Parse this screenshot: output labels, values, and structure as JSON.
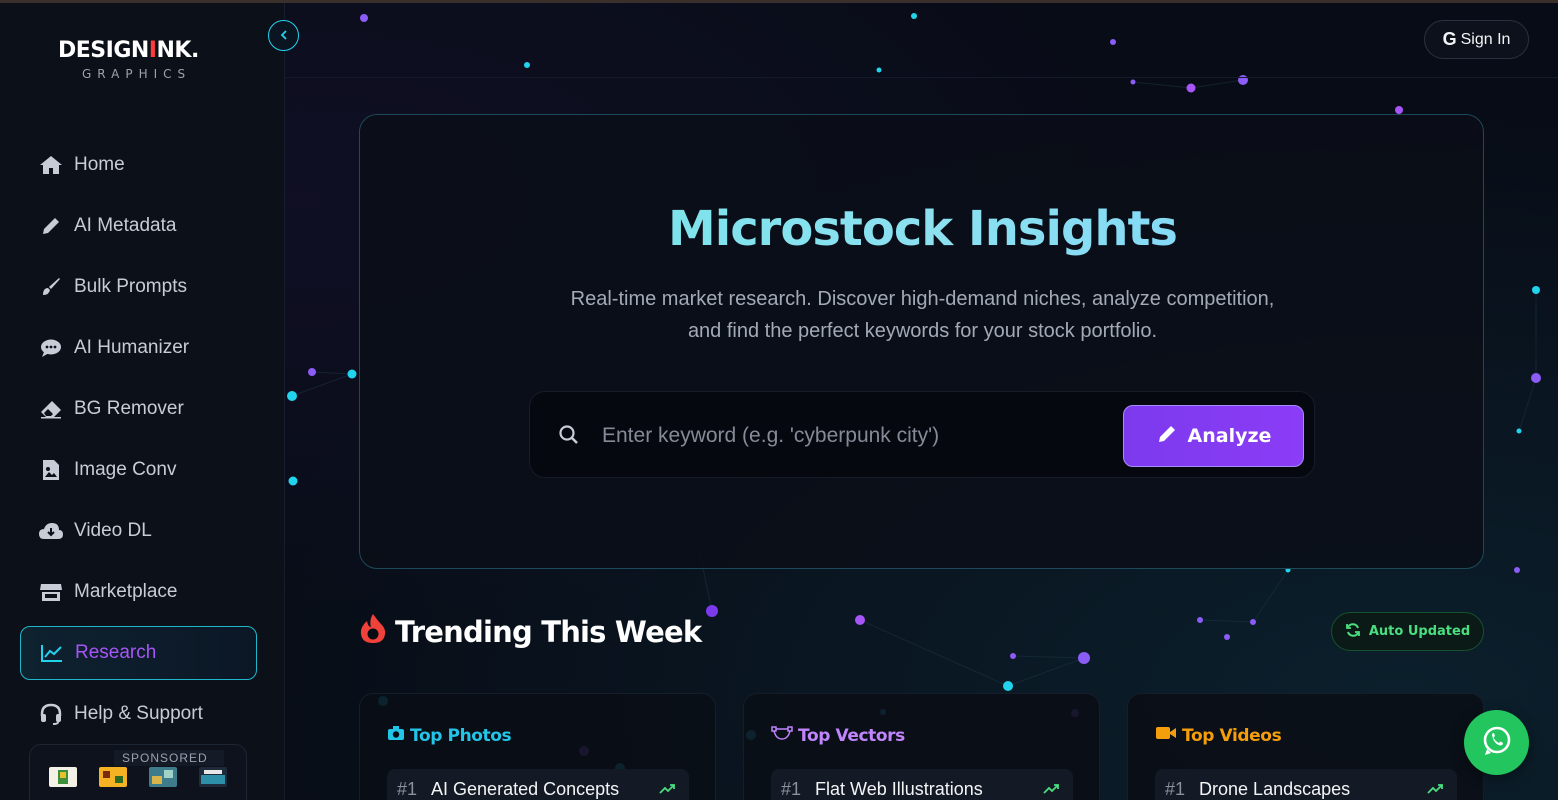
{
  "brand": {
    "name_pre": "DESIGN",
    "name_i": "I",
    "name_post": "NK.",
    "tagline": "GRAPHICS"
  },
  "sidebar": {
    "items": [
      {
        "label": "Home",
        "icon": "home-icon"
      },
      {
        "label": "AI Metadata",
        "icon": "pencil-icon"
      },
      {
        "label": "Bulk Prompts",
        "icon": "brush-icon"
      },
      {
        "label": "AI Humanizer",
        "icon": "chat-icon"
      },
      {
        "label": "BG Remover",
        "icon": "eraser-icon"
      },
      {
        "label": "Image Conv",
        "icon": "file-image-icon"
      },
      {
        "label": "Video DL",
        "icon": "cloud-download-icon"
      },
      {
        "label": "Marketplace",
        "icon": "store-icon"
      },
      {
        "label": "Research",
        "icon": "chart-line-icon",
        "active": true
      },
      {
        "label": "Help & Support",
        "icon": "headset-icon"
      }
    ],
    "sponsored_label": "SPONSORED"
  },
  "header": {
    "signin_g": "G",
    "signin_label": "Sign In"
  },
  "hero": {
    "title": "Microstock Insights",
    "subtitle": "Real-time market research. Discover high-demand niches, analyze competition, and find the perfect keywords for your stock portfolio.",
    "search_placeholder": "Enter keyword (e.g. 'cyberpunk city')",
    "search_value": "",
    "analyze_label": "Analyze"
  },
  "trending": {
    "title": "Trending This Week",
    "badge": "Auto Updated",
    "columns": [
      {
        "title": "Top Photos",
        "color": "#22c5e8",
        "icon": "camera-icon",
        "rank": "#1",
        "item": "AI Generated Concepts"
      },
      {
        "title": "Top Vectors",
        "color": "#c084fc",
        "icon": "vector-path-icon",
        "rank": "#1",
        "item": "Flat Web Illustrations"
      },
      {
        "title": "Top Videos",
        "color": "#f59e0b",
        "icon": "video-camera-icon",
        "rank": "#1",
        "item": "Drone Landscapes"
      }
    ]
  },
  "colors": {
    "accent_cyan": "#22d3ee",
    "accent_purple": "#8b3cf6",
    "accent_green": "#4ade80",
    "brand_red": "#ff3b3b",
    "whatsapp": "#22c55e"
  }
}
